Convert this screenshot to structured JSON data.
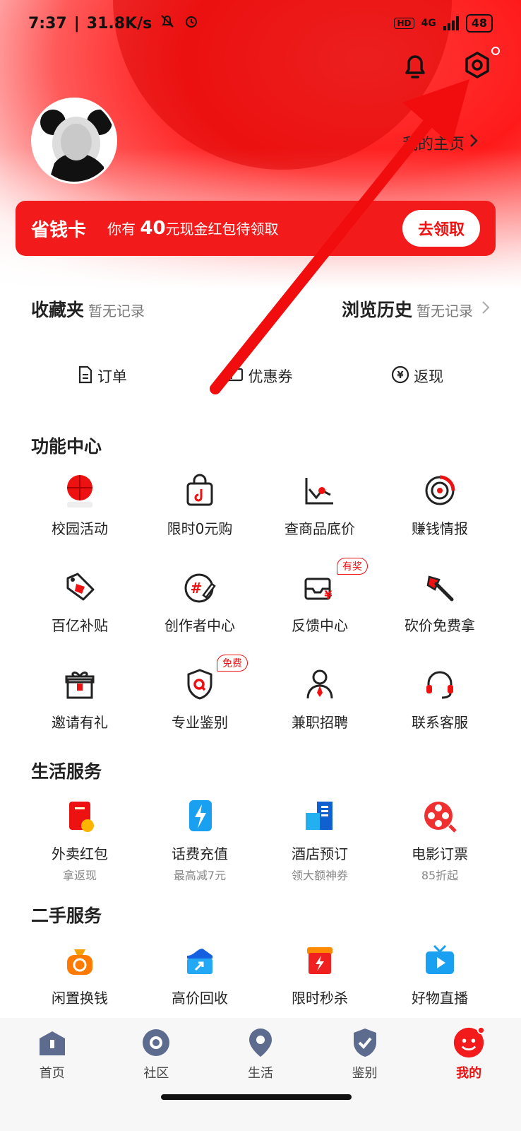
{
  "colors": {
    "accent": "#f21a1a",
    "text": "#222222",
    "muted": "#888888"
  },
  "status_bar": {
    "time": "7:37",
    "speed": "31.8K/s",
    "network": "4G",
    "battery": "48"
  },
  "header": {
    "bell_icon": "bell-icon",
    "settings_icon": "gear-icon",
    "homepage_label": "我的主页"
  },
  "saving_card": {
    "title": "省钱卡",
    "text_pre": "你有",
    "amount": "40",
    "text_post": "元现金红包待领取",
    "button": "去领取"
  },
  "favorites": {
    "fav_label": "收藏夹",
    "fav_status": "暂无记录",
    "history_label": "浏览历史",
    "history_status": "暂无记录"
  },
  "quick_links": [
    {
      "label": "订单",
      "icon": "document-icon"
    },
    {
      "label": "优惠券",
      "icon": "coupon-icon"
    },
    {
      "label": "返现",
      "icon": "yuan-circle-icon"
    }
  ],
  "function_center": {
    "title": "功能中心",
    "items": [
      {
        "label": "校园活动",
        "icon": "basketball-icon"
      },
      {
        "label": "限时0元购",
        "icon": "shopping-bag-icon"
      },
      {
        "label": "查商品底价",
        "icon": "price-chart-icon"
      },
      {
        "label": "赚钱情报",
        "icon": "target-icon"
      },
      {
        "label": "百亿补贴",
        "icon": "price-tag-icon"
      },
      {
        "label": "创作者中心",
        "icon": "pencil-hash-icon"
      },
      {
        "label": "反馈中心",
        "icon": "feedback-inbox-icon",
        "badge": "有奖"
      },
      {
        "label": "砍价免费拿",
        "icon": "axe-icon"
      },
      {
        "label": "邀请有礼",
        "icon": "gift-icon"
      },
      {
        "label": "专业鉴别",
        "icon": "shield-search-icon",
        "badge": "免费"
      },
      {
        "label": "兼职招聘",
        "icon": "person-tie-icon"
      },
      {
        "label": "联系客服",
        "icon": "headset-icon"
      }
    ]
  },
  "life_services": {
    "title": "生活服务",
    "items": [
      {
        "label": "外卖红包",
        "sub": "拿返现",
        "icon": "red-envelope-icon"
      },
      {
        "label": "话费充值",
        "sub": "最高减7元",
        "icon": "lightning-phone-icon"
      },
      {
        "label": "酒店预订",
        "sub": "领大额神券",
        "icon": "hotel-building-icon"
      },
      {
        "label": "电影订票",
        "sub": "85折起",
        "icon": "film-reel-icon"
      }
    ]
  },
  "second_hand": {
    "title": "二手服务",
    "items": [
      {
        "label": "闲置换钱",
        "icon": "money-bag-icon"
      },
      {
        "label": "高价回收",
        "icon": "sneaker-box-icon"
      },
      {
        "label": "限时秒杀",
        "icon": "flash-box-icon"
      },
      {
        "label": "好物直播",
        "icon": "tv-play-icon"
      }
    ]
  },
  "bottom_nav": [
    {
      "label": "首页",
      "icon": "home-icon"
    },
    {
      "label": "社区",
      "icon": "community-icon"
    },
    {
      "label": "生活",
      "icon": "location-pin-icon"
    },
    {
      "label": "鉴别",
      "icon": "shield-check-icon"
    },
    {
      "label": "我的",
      "icon": "profile-face-icon"
    }
  ]
}
